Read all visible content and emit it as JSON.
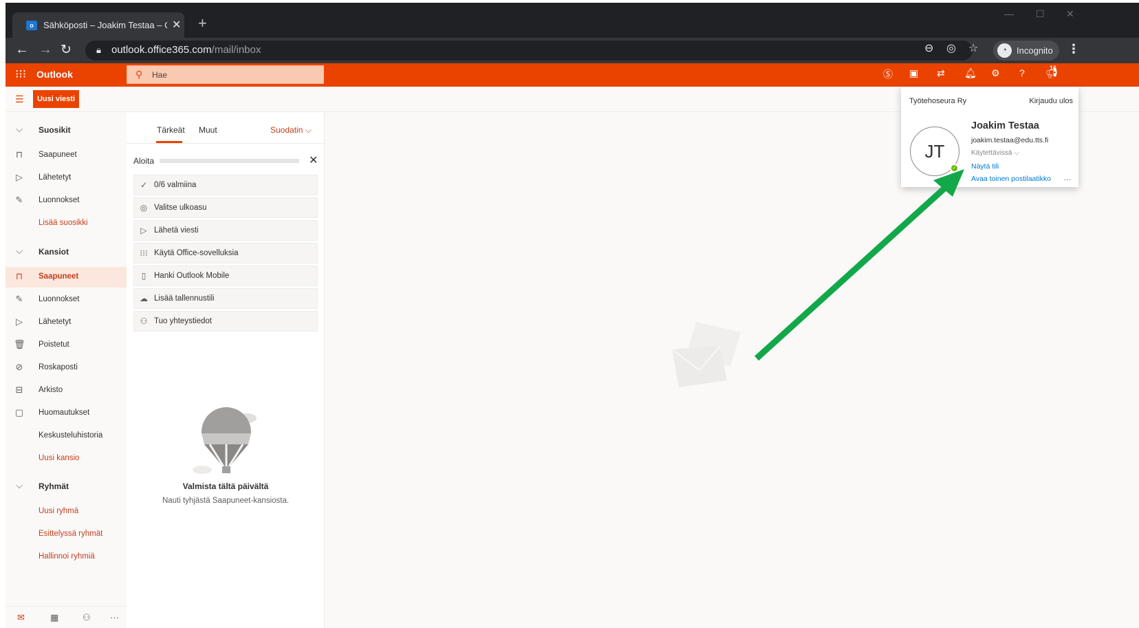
{
  "browser": {
    "tab_title": "Sähköposti – Joakim Testaa – Ou",
    "tab_close": "✕",
    "new_tab": "+",
    "url_host": "outlook.office365.com",
    "url_path": "/mail/inbox",
    "incognito_label": "Incognito"
  },
  "header": {
    "app_name": "Outlook",
    "search_placeholder": "Hae",
    "notification_count": "16"
  },
  "command": {
    "new_message": "Uusi viesti"
  },
  "nav": {
    "favorites_header": "Suosikit",
    "favorites": [
      "Saapuneet",
      "Lähetetyt",
      "Luonnokset"
    ],
    "add_favorite": "Lisää suosikki",
    "folders_header": "Kansiot",
    "folders": [
      "Saapuneet",
      "Luonnokset",
      "Lähetetyt",
      "Poistetut",
      "Roskaposti",
      "Arkisto",
      "Huomautukset",
      "Keskusteluhistoria"
    ],
    "new_folder": "Uusi kansio",
    "groups_header": "Ryhmät",
    "new_group": "Uusi ryhmä",
    "featured_groups": "Esittelyssä ryhmät",
    "manage_groups": "Hallinnoi ryhmiä",
    "selected_folder": "Saapuneet"
  },
  "list": {
    "tab_focused": "Tärkeät",
    "tab_other": "Muut",
    "filter": "Suodatin",
    "getting_started": "Aloita",
    "progress": 0,
    "tasks": [
      "0/6 valmiina",
      "Valitse ulkoasu",
      "Lähetä viesti",
      "Käytä Office-sovelluksia",
      "Hanki Outlook Mobile",
      "Lisää tallennustili",
      "Tuo yhteystiedot"
    ],
    "empty_title": "Valmista tältä päivältä",
    "empty_subtitle": "Nauti tyhjästä Saapuneet-kansiosta."
  },
  "account": {
    "organization": "Työtehoseura Ry",
    "sign_out": "Kirjaudu ulos",
    "initials": "JT",
    "name": "Joakim Testaa",
    "email": "joakim.testaa@edu.tts.fi",
    "status": "Käytettävissä",
    "view_account": "Näytä tili",
    "open_other_mailbox": "Avaa toinen postilaatikko",
    "more": "…"
  },
  "colors": {
    "brand": "#ea4300",
    "annotation_arrow": "#12a84a"
  }
}
